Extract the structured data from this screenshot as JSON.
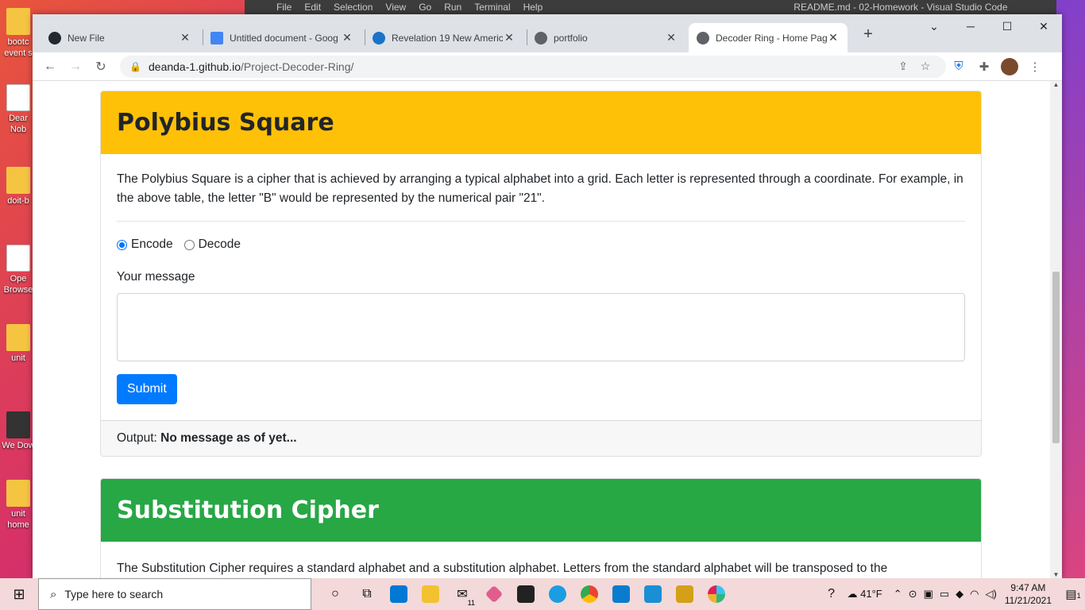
{
  "desktop": {
    "icons": [
      {
        "label": "bootc event s",
        "kind": "folder"
      },
      {
        "label": "Dear Nob",
        "kind": "doc"
      },
      {
        "label": "doit-b",
        "kind": "folder"
      },
      {
        "label": "Ope Browse",
        "kind": "doc"
      },
      {
        "label": "unit",
        "kind": "folder"
      },
      {
        "label": "We Dow",
        "kind": "dark"
      },
      {
        "label": "unit home",
        "kind": "folder"
      }
    ]
  },
  "vscode": {
    "menus": [
      "File",
      "Edit",
      "Selection",
      "View",
      "Go",
      "Run",
      "Terminal",
      "Help"
    ],
    "title": "README.md - 02-Homework - Visual Studio Code"
  },
  "browser": {
    "tabs": [
      {
        "label": "New File",
        "icon": "github-icon",
        "active": false
      },
      {
        "label": "Untitled document - Goog",
        "icon": "google-docs-icon",
        "active": false
      },
      {
        "label": "Revelation 19 New Americ",
        "icon": "bible-icon",
        "active": false
      },
      {
        "label": "portfolio",
        "icon": "globe-icon",
        "active": false
      },
      {
        "label": "Decoder Ring - Home Pag",
        "icon": "globe-icon",
        "active": true
      }
    ],
    "url_host": "deanda-1.github.io",
    "url_path": "/Project-Decoder-Ring/"
  },
  "polybius": {
    "title": "Polybius Square",
    "description": "The Polybius Square is a cipher that is achieved by arranging a typical alphabet into a grid. Each letter is represented through a coordinate. For example, in the above table, the letter \"B\" would be represented by the numerical pair \"21\".",
    "encode_label": "Encode",
    "decode_label": "Decode",
    "selected_mode": "Encode",
    "message_label": "Your message",
    "message_value": "",
    "submit_label": "Submit",
    "output_label": "Output:",
    "output_value": "No message as of yet..."
  },
  "substitution": {
    "title": "Substitution Cipher",
    "description": "The Substitution Cipher requires a standard alphabet and a substitution alphabet. Letters from the standard alphabet will be transposed to the"
  },
  "taskbar": {
    "search_placeholder": "Type here to search",
    "temperature": "41°F",
    "time": "9:47 AM",
    "date": "11/21/2021",
    "notification_count": "1",
    "mail_badge": "11"
  },
  "colors": {
    "polybius_header": "#ffc107",
    "substitution_header": "#28a745",
    "submit_button": "#007bff"
  }
}
